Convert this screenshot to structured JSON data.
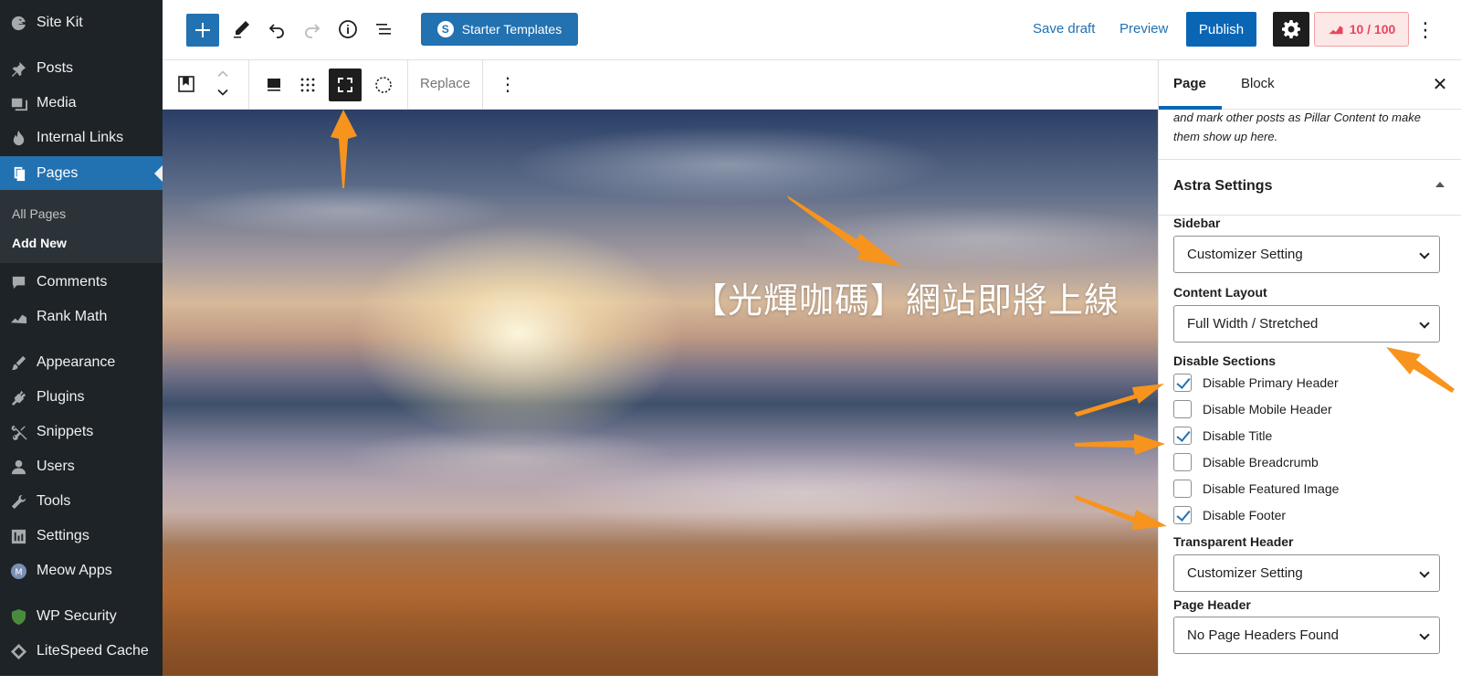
{
  "sidebar": {
    "items": [
      {
        "label": "Site Kit",
        "icon": "google-g-icon"
      },
      {
        "label": "Posts",
        "icon": "pin-icon"
      },
      {
        "label": "Media",
        "icon": "media-icon"
      },
      {
        "label": "Internal Links",
        "icon": "flame-icon"
      },
      {
        "label": "Pages",
        "icon": "pages-icon",
        "active": true
      },
      {
        "label": "Comments",
        "icon": "comment-icon"
      },
      {
        "label": "Rank Math",
        "icon": "rank-math-icon"
      },
      {
        "label": "Appearance",
        "icon": "brush-icon"
      },
      {
        "label": "Plugins",
        "icon": "plug-icon"
      },
      {
        "label": "Snippets",
        "icon": "scissors-icon"
      },
      {
        "label": "Users",
        "icon": "user-icon"
      },
      {
        "label": "Tools",
        "icon": "wrench-icon"
      },
      {
        "label": "Settings",
        "icon": "sliders-icon"
      },
      {
        "label": "Meow Apps",
        "icon": "meow-apps-icon"
      },
      {
        "label": "WP Security",
        "icon": "shield-icon"
      },
      {
        "label": "LiteSpeed Cache",
        "icon": "diamond-icon"
      }
    ],
    "submenu": {
      "all_pages": "All Pages",
      "add_new": "Add New"
    }
  },
  "header": {
    "starter_templates": "Starter Templates",
    "starter_logo": "S",
    "save_draft": "Save draft",
    "preview": "Preview",
    "publish": "Publish",
    "seo_score": "10 / 100",
    "more": "⋮"
  },
  "toolbar": {
    "replace": "Replace",
    "more": "⋮"
  },
  "canvas": {
    "title": "【光輝咖碼】網站即將上線"
  },
  "panel": {
    "tabs": {
      "page": "Page",
      "block": "Block"
    },
    "close": "✕",
    "pillar_note": "and mark other posts as Pillar Content to make them show up here.",
    "astra_title": "Astra Settings",
    "sidebar_label": "Sidebar",
    "sidebar_value": "Customizer Setting",
    "content_layout_label": "Content Layout",
    "content_layout_value": "Full Width / Stretched",
    "disable_sections_label": "Disable Sections",
    "checkboxes": [
      {
        "label": "Disable Primary Header",
        "checked": true
      },
      {
        "label": "Disable Mobile Header",
        "checked": false
      },
      {
        "label": "Disable Title",
        "checked": true
      },
      {
        "label": "Disable Breadcrumb",
        "checked": false
      },
      {
        "label": "Disable Featured Image",
        "checked": false
      },
      {
        "label": "Disable Footer",
        "checked": true
      }
    ],
    "transparent_header_label": "Transparent Header",
    "transparent_header_value": "Customizer Setting",
    "page_header_label": "Page Header",
    "page_header_value": "No Page Headers Found"
  },
  "colors": {
    "wp_blue": "#2271b1",
    "publish_blue": "#0a66b5",
    "admin_dark": "#1d2327",
    "annotation_orange": "#f7941d",
    "seo_red": "#e7475e"
  }
}
